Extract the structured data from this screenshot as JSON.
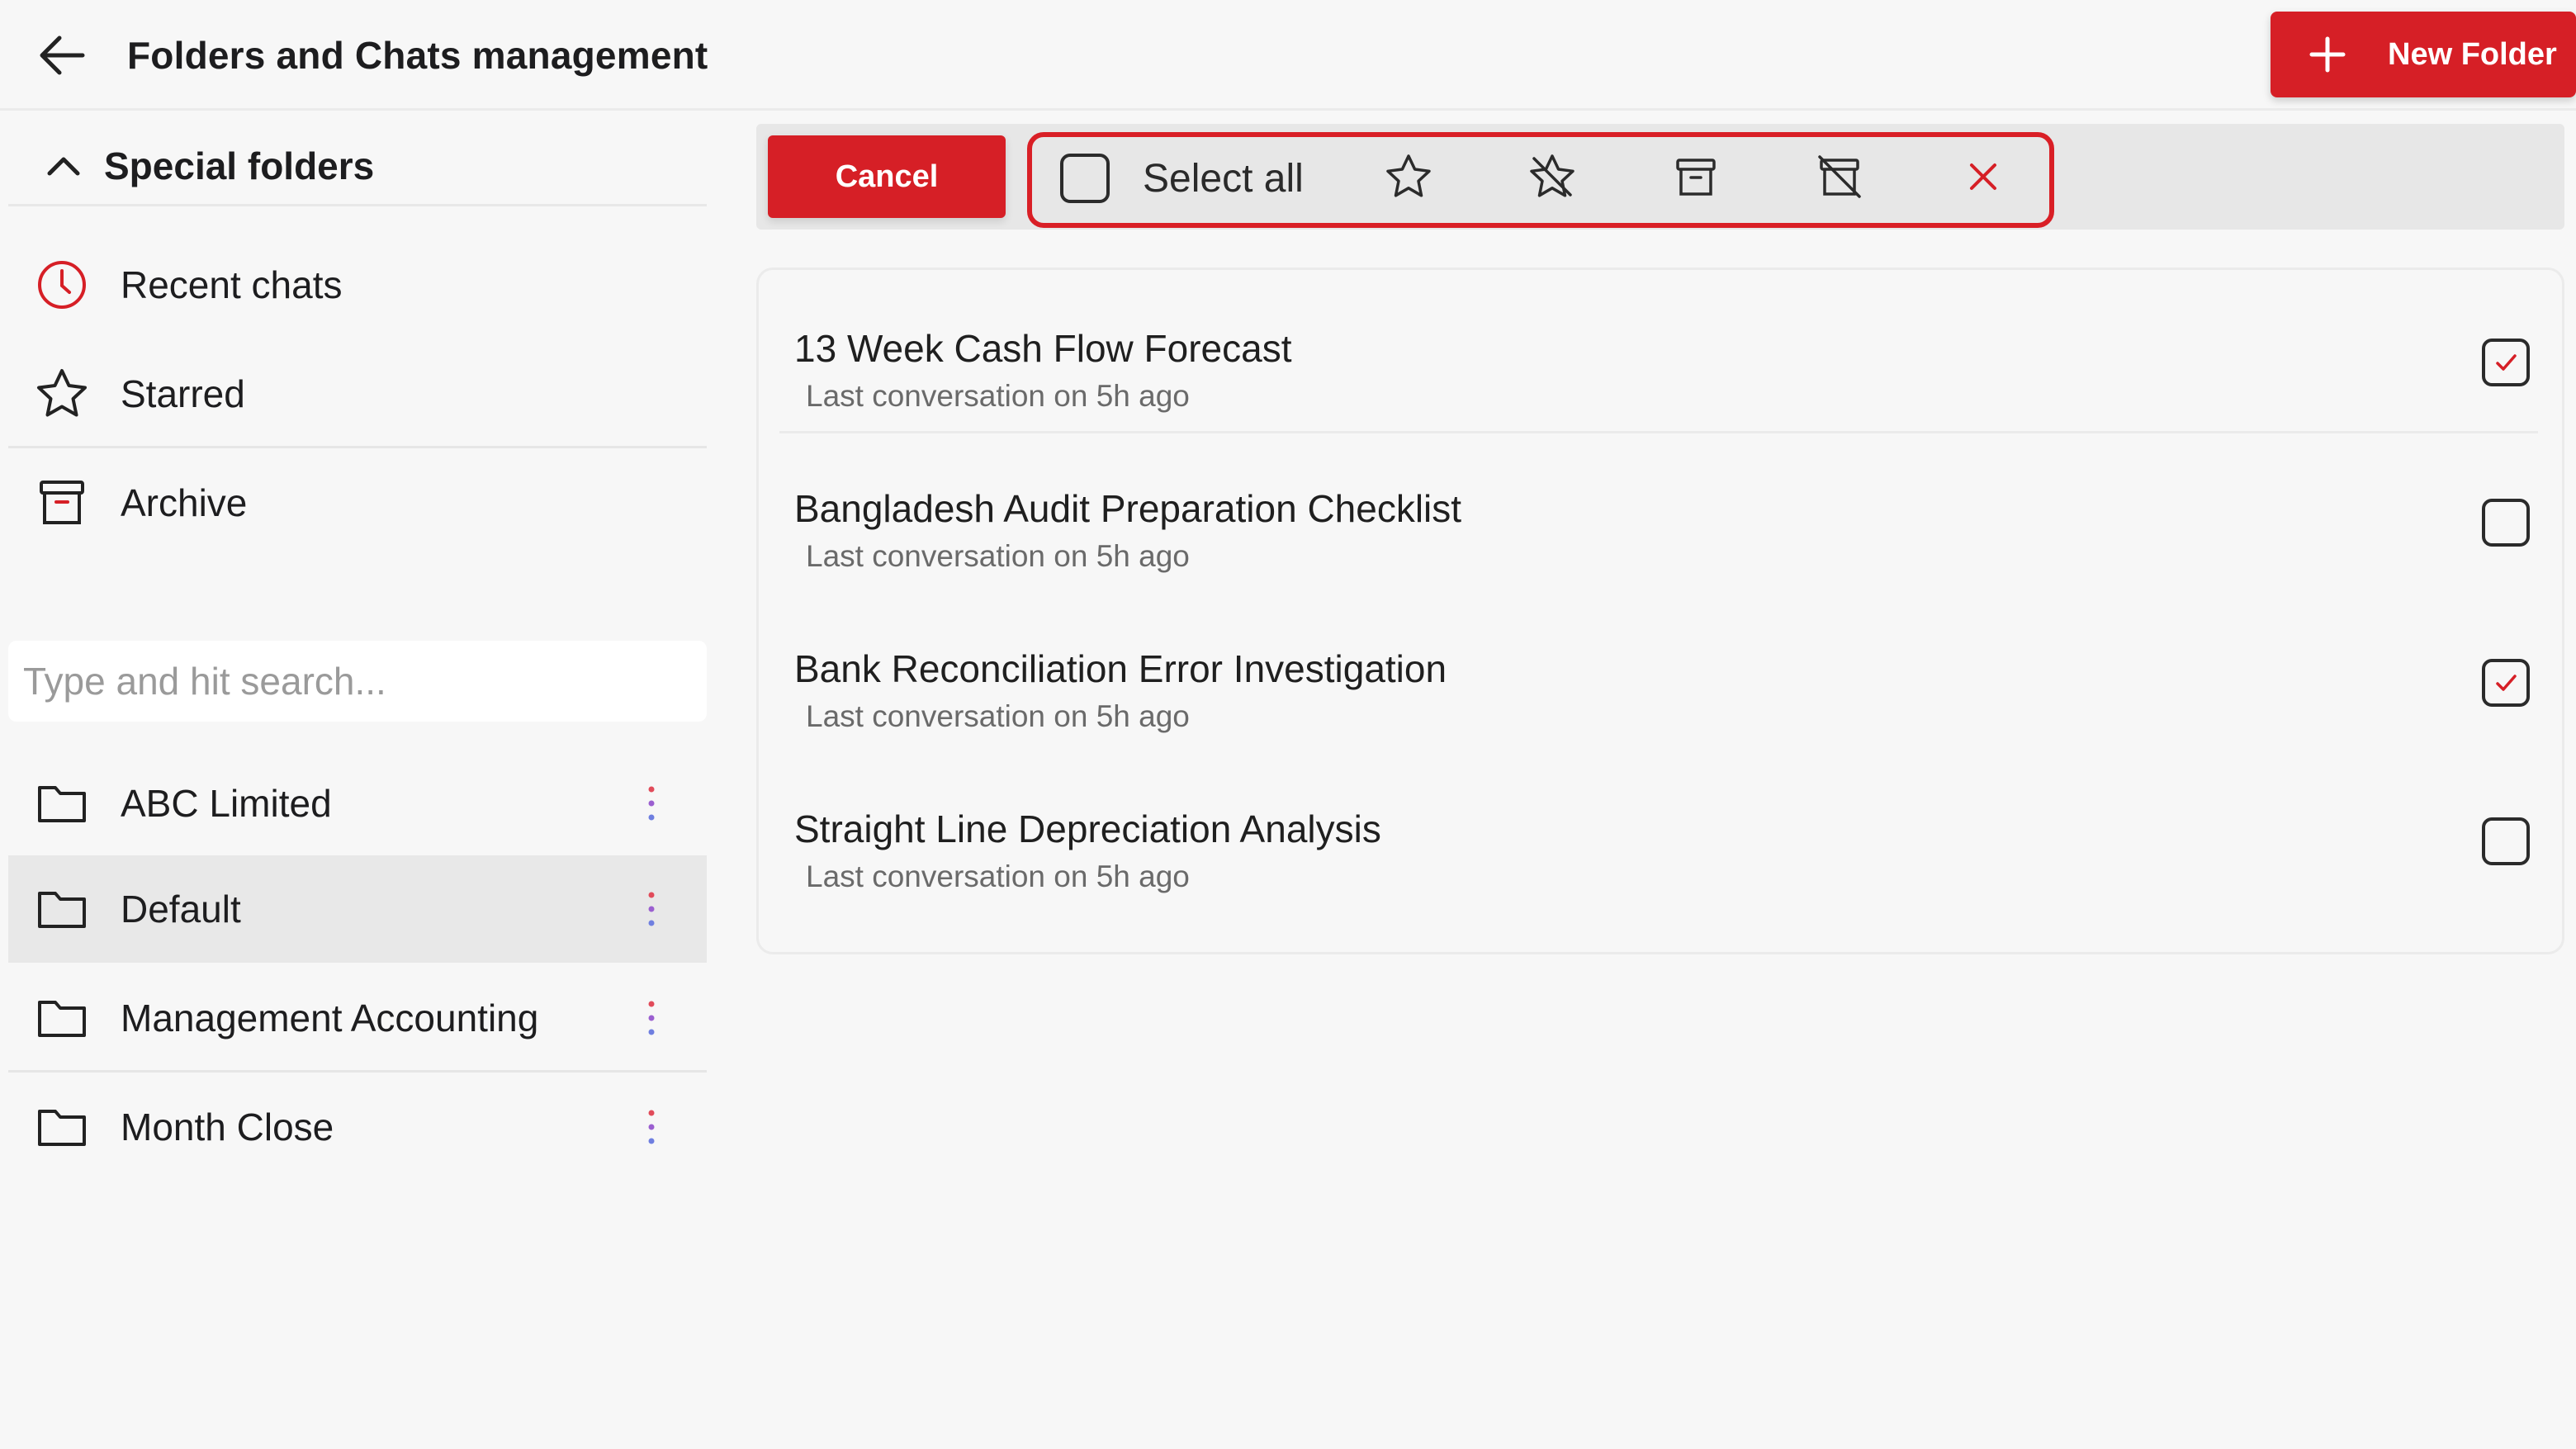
{
  "header": {
    "title": "Folders and Chats management",
    "new_folder_label": "New Folder"
  },
  "sidebar": {
    "special_section_title": "Special folders",
    "special_items": [
      {
        "label": "Recent chats",
        "icon": "clock-icon"
      },
      {
        "label": "Starred",
        "icon": "star-icon"
      },
      {
        "label": "Archive",
        "icon": "archive-icon"
      }
    ],
    "search": {
      "placeholder": "Type and hit search...",
      "value": ""
    },
    "folders": [
      {
        "label": "ABC Limited",
        "icon": "folder-icon",
        "selected": false
      },
      {
        "label": "Default",
        "icon": "folder-icon",
        "selected": true
      },
      {
        "label": "Management Accounting",
        "icon": "folder-icon",
        "selected": false
      },
      {
        "label": "Month Close",
        "icon": "folder-icon",
        "selected": false
      }
    ]
  },
  "toolbar": {
    "cancel_label": "Cancel",
    "select_all_label": "Select all",
    "select_all_checked": false,
    "actions": [
      "star-icon",
      "unstar-icon",
      "archive-icon",
      "unarchive-icon",
      "close-icon"
    ]
  },
  "chats": [
    {
      "title": "13 Week Cash Flow Forecast",
      "subtitle": "Last conversation on 5h ago",
      "checked": true
    },
    {
      "title": "Bangladesh Audit Preparation Checklist",
      "subtitle": "Last conversation on 5h ago",
      "checked": false
    },
    {
      "title": "Bank Reconciliation Error Investigation",
      "subtitle": "Last conversation on 5h ago",
      "checked": true
    },
    {
      "title": "Straight Line Depreciation Analysis",
      "subtitle": "Last conversation on 5h ago",
      "checked": false
    }
  ],
  "colors": {
    "accent": "#d61f26",
    "background": "#f7f7f7",
    "toolbar_bg": "#e7e7e7",
    "selected_row_bg": "#e8e8e8",
    "kebab_dot_top": "#e14b5a",
    "kebab_dot_mid": "#9b5fd0",
    "kebab_dot_bottom": "#6f7fe0"
  }
}
